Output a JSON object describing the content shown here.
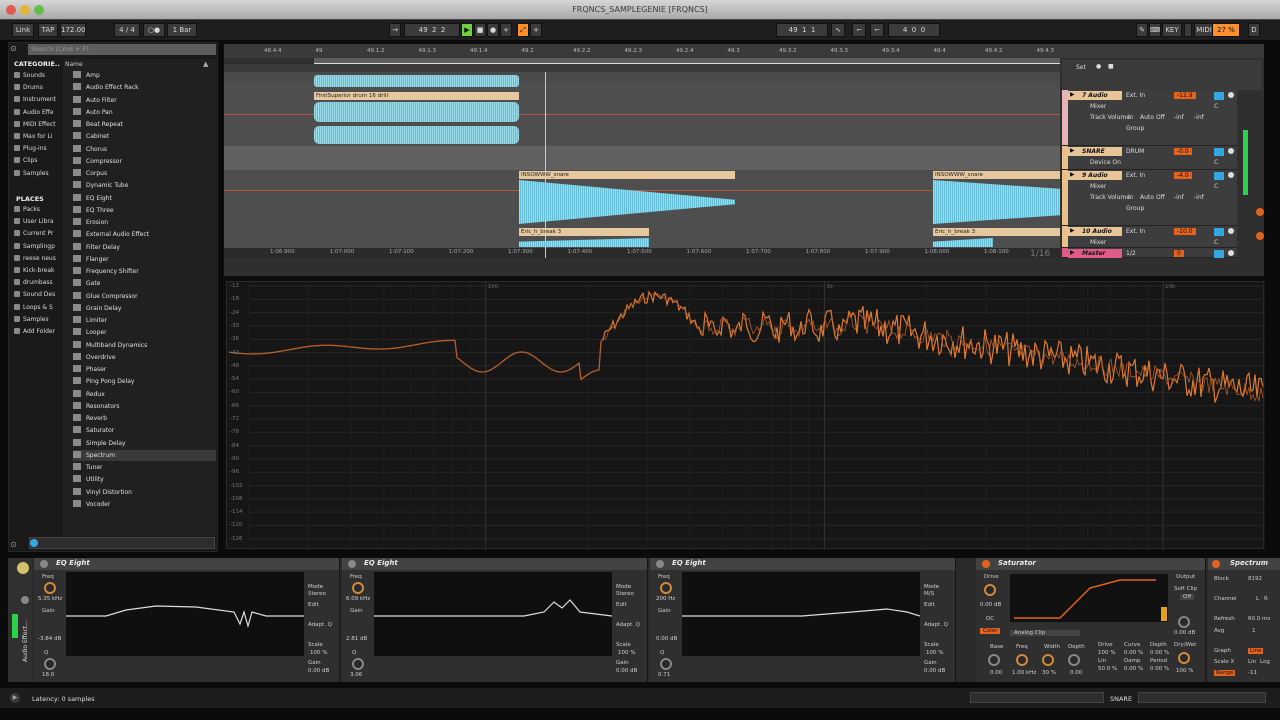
{
  "window_title": "FRQNCS_SAMPLEGENIE  [FRQNCS]",
  "transport": {
    "link": "Link",
    "tap": "TAP",
    "tempo": "172.00",
    "sig": "4 / 4",
    "quant": "1 Bar",
    "pos_bar": "49",
    "pos_beat": "2",
    "pos_sixteenth": "2",
    "loop_start_bar": "49",
    "loop_start_beat": "1",
    "loop_start_sixteenth": "1",
    "loop_len_bar": "4",
    "loop_len_beat": "0",
    "loop_len_sixteenth": "0",
    "key": "KEY",
    "midi": "MIDI",
    "cpu": "27 %",
    "d": "D"
  },
  "browser": {
    "search_placeholder": "Search (Cmd + F)",
    "categories_header": "CATEGORIE..",
    "categories": [
      "Sounds",
      "Drums",
      "Instrument",
      "Audio Effe",
      "MIDI Effect",
      "Max for Li",
      "Plug-ins",
      "Clips",
      "Samples"
    ],
    "places_header": "PLACES",
    "places": [
      "Packs",
      "User Libra",
      "Current Pr",
      "Samplingp",
      "reese neus",
      "Kick-break",
      "drumbass",
      "Sound Des",
      "Loops & S",
      "Samples",
      "Add Folder"
    ],
    "name_header": "Name",
    "items": [
      "Amp",
      "Audio Effect Rack",
      "Auto Filter",
      "Auto Pan",
      "Beat Repeat",
      "Cabinet",
      "Chorus",
      "Compressor",
      "Corpus",
      "Dynamic Tube",
      "EQ Eight",
      "EQ Three",
      "Erosion",
      "External Audio Effect",
      "Filter Delay",
      "Flanger",
      "Frequency Shifter",
      "Gate",
      "Glue Compressor",
      "Grain Delay",
      "Limiter",
      "Looper",
      "Multiband Dynamics",
      "Overdrive",
      "Phaser",
      "Ping Pong Delay",
      "Redux",
      "Resonators",
      "Reverb",
      "Saturator",
      "Simple Delay",
      "Spectrum",
      "Tuner",
      "Utility",
      "Vinyl Distortion",
      "Vocoder"
    ],
    "selected_item": "Spectrum"
  },
  "arrangement": {
    "ruler": [
      "48.4.4",
      "49",
      "49.1.2",
      "49.1.3",
      "49.1.4",
      "49.2",
      "49.2.2",
      "49.2.3",
      "49.2.4",
      "49.3",
      "49.3.2",
      "49.3.3",
      "49.3.4",
      "49.4",
      "49.4.2",
      "49.4.3"
    ],
    "time_ruler": [
      "1:06:900",
      "1:07:000",
      "1:07:100",
      "1:07:200",
      "1:07:300",
      "1:07:400",
      "1:07:500",
      "1:07:600",
      "1:07:700",
      "1:07:800",
      "1:07:900",
      "1:08:000",
      "1:08:100"
    ],
    "zoom_label": "1/16",
    "clips": {
      "drum": "FirstSuperior drum 16 drill",
      "snare_a": "INSOWWW_snare",
      "snare_b": "INSOWWW_snare",
      "break_a": "Eric_h_break 3",
      "break_b": "Eric_h_break 3"
    }
  },
  "mixer": {
    "set": "Set",
    "tracks": [
      {
        "name": "7 Audio",
        "input": "Ext. In",
        "monitor": "Mixer",
        "param": "Track Volume",
        "in": "In",
        "auto": "Auto",
        "off": "Off",
        "group": "Group",
        "vol": "-12.9",
        "send": "C",
        "a": "-inf",
        "b": "-inf"
      },
      {
        "name": "SNARE",
        "input": "DRUM",
        "monitor": "Device On",
        "param": "Track In",
        "vol": "-0.0",
        "send": "C"
      },
      {
        "name": "9 Audio",
        "input": "Ext. In",
        "monitor": "Mixer",
        "param": "Track Volume",
        "in": "In",
        "auto": "Auto",
        "off": "Off",
        "group": "Group",
        "vol": "-4.0",
        "send": "C",
        "a": "-inf",
        "b": "-inf"
      },
      {
        "name": "10 Audio",
        "input": "Ext. In",
        "monitor": "Mixer",
        "vol": "-10.0",
        "send": "C"
      },
      {
        "name": "Master",
        "input": "1/2",
        "vol": "0"
      }
    ]
  },
  "spectrum": {
    "db_labels": [
      "-12",
      "-18",
      "-24",
      "-30",
      "-36",
      "-42",
      "-48",
      "-54",
      "-60",
      "-66",
      "-72",
      "-78",
      "-84",
      "-90",
      "-96",
      "-102",
      "-108",
      "-114",
      "-120",
      "-126"
    ],
    "freq_labels": [
      "100",
      "1k",
      "10k"
    ]
  },
  "devices": {
    "side_label": "Audio Effect...",
    "eq1": {
      "title": "EQ Eight",
      "freq_label": "Freq",
      "freq": "5.35 kHz",
      "gain_label": "Gain",
      "gain": "-3.84 dB",
      "q_label": "Q",
      "q": "18.0",
      "mode_label": "Mode",
      "mode": "Stereo",
      "edit": "Edit",
      "adapt": "Adapt. Q",
      "scale_label": "Scale",
      "scale": "100 %",
      "out_label": "Gain",
      "out": "0.00 dB"
    },
    "eq2": {
      "title": "EQ Eight",
      "freq_label": "Freq",
      "freq": "6.09 kHz",
      "gain_label": "Gain",
      "gain": "2.81 dB",
      "q_label": "Q",
      "q": "3.06",
      "mode_label": "Mode",
      "mode": "Stereo",
      "edit": "Edit",
      "adapt": "Adapt. Q",
      "scale_label": "Scale",
      "scale": "100 %",
      "out_label": "Gain",
      "out": "0.00 dB"
    },
    "eq3": {
      "title": "EQ Eight",
      "freq_label": "Freq",
      "freq": "200 Hz",
      "gain_label": "Gain",
      "gain": "0.00 dB",
      "q_label": "Q",
      "q": "0.71",
      "mode_label": "Mode",
      "mode": "M/S",
      "edit": "Edit",
      "adapt": "Adapt. Q",
      "scale_label": "Scale",
      "scale": "100 %",
      "out_label": "Gain",
      "out": "0.00 dB"
    },
    "sat": {
      "title": "Saturator",
      "drive_label": "Drive",
      "drive": "0.00 dB",
      "dc": "DC",
      "color": "Color",
      "type": "Analog Clip",
      "base": "Base",
      "freq": "Freq",
      "width": "Width",
      "depth": "Depth",
      "base_v": "0.00",
      "freq_v": "1.00 kHz",
      "width_v": "30 %",
      "depth_v": "0.00",
      "drive2": "Drive",
      "curve": "Curve",
      "depth2": "Depth",
      "lin": "Lin",
      "damp": "Damp",
      "period": "Period",
      "d2v": "100 %",
      "cv": "0.00 %",
      "dpv": "0.00 %",
      "lv": "50.0 %",
      "dmv": "0.00 %",
      "pv": "0.00 %",
      "output_label": "Output",
      "soft_clip": "Soft Clip",
      "off": "Off",
      "out_v": "0.00 dB",
      "drywet": "Dry/Wet",
      "dw_v": "100 %"
    },
    "spectrum_dev": {
      "title": "Spectrum",
      "block_label": "Block",
      "block": "8192",
      "channel_label": "Channel",
      "l": "L",
      "r": "R",
      "refresh_label": "Refresh",
      "refresh": "60.0 ms",
      "avg_label": "Avg",
      "avg": "1",
      "graph_label": "Graph",
      "graph": "Line",
      "scale_label": "Scale X",
      "lin": "Lin",
      "log": "Log",
      "range_label": "Range",
      "range": "-11"
    }
  },
  "status": {
    "latency": "Latency: 0 samples",
    "track": "SNARE"
  }
}
